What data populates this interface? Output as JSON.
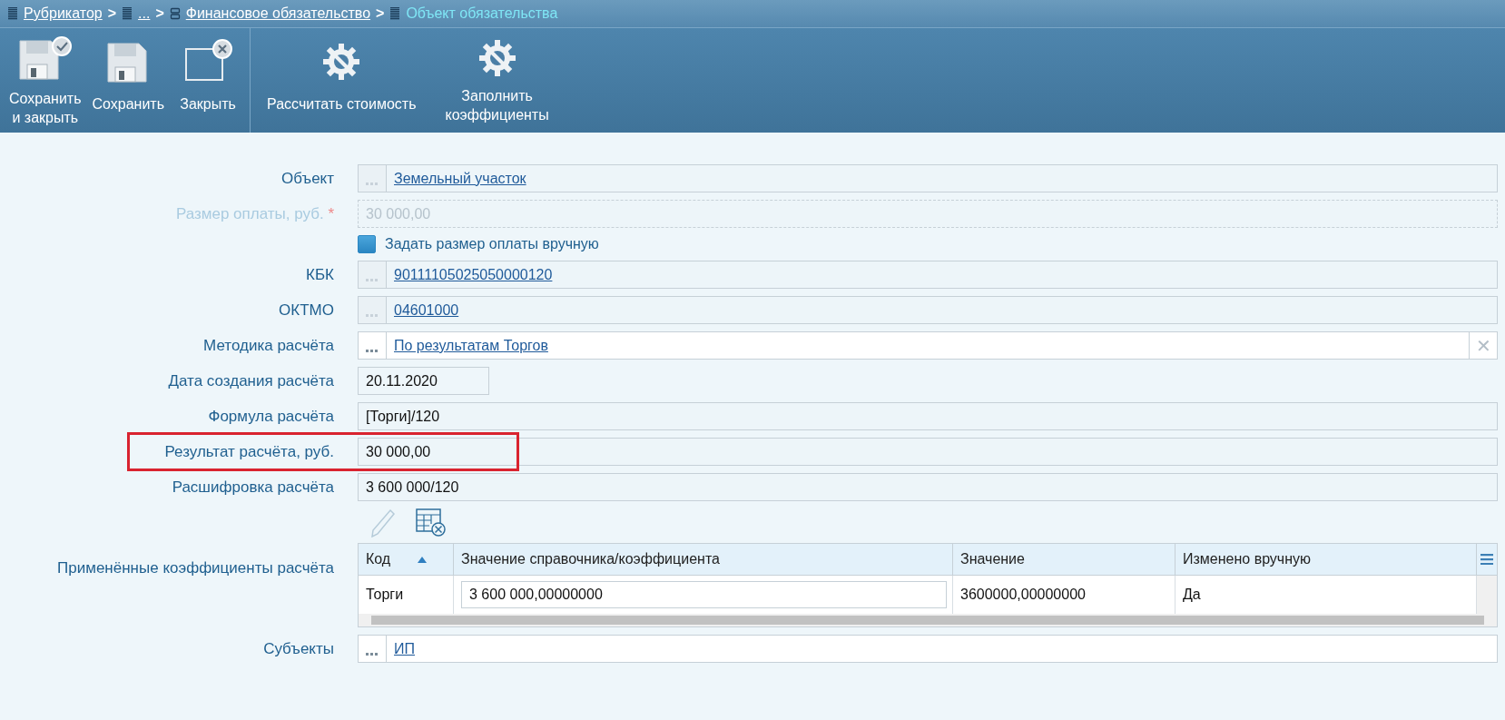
{
  "breadcrumbs": [
    {
      "label": "Рубрикатор",
      "current": false,
      "separator": ">"
    },
    {
      "label": "...",
      "current": false,
      "separator": ">"
    },
    {
      "label": "Финансовое обязательство",
      "current": false,
      "separator": ">"
    },
    {
      "label": "Объект обязательства",
      "current": true
    }
  ],
  "toolbar": {
    "groups": [
      [
        {
          "label": "Сохранить\nи закрыть"
        },
        {
          "label": "Сохранить"
        },
        {
          "label": "Закрыть"
        }
      ],
      [
        {
          "label": "Рассчитать стоимость"
        },
        {
          "label": "Заполнить\nкоэффициенты"
        }
      ]
    ]
  },
  "form": {
    "fields": [
      {
        "kind": "lookup",
        "label": "Объект",
        "value": "Земельный участок",
        "editable": false
      },
      {
        "kind": "text",
        "label": "Размер оплаты, руб.",
        "required_mark": "*",
        "value": "30 000,00",
        "disabled": true
      },
      {
        "kind": "checkbox",
        "label": "Задать размер оплаты вручную",
        "checked": true
      },
      {
        "kind": "lookup",
        "label": "КБК",
        "value": "90111105025050000120",
        "editable": false
      },
      {
        "kind": "lookup",
        "label": "ОКТМО",
        "value": "04601000",
        "editable": false
      },
      {
        "kind": "lookup",
        "label": "Методика расчёта",
        "value": "По результатам Торгов",
        "editable": true,
        "clear": "✕"
      },
      {
        "kind": "date",
        "label": "Дата создания расчёта",
        "value": "20.11.2020"
      },
      {
        "kind": "text",
        "label": "Формула расчёта",
        "value": "[Торги]/120",
        "disabled": false
      },
      {
        "kind": "text",
        "label": "Результат расчёта, руб.",
        "value": "30 000,00",
        "disabled": false,
        "highlighted": true
      },
      {
        "kind": "text",
        "label": "Расшифровка расчёта",
        "value": "3 600 000/120",
        "disabled": false
      },
      {
        "kind": "table",
        "label": "Применённые коэффициенты расчёта",
        "tools": [
          {
            "disabled": true
          },
          {
            "disabled": false
          }
        ],
        "columns": [
          {
            "label": "Код",
            "sorted": true
          },
          {
            "label": "Значение справочника/коэффициента",
            "sorted": false
          },
          {
            "label": "Значение",
            "sorted": false
          },
          {
            "label": "Изменено вручную",
            "sorted": false
          }
        ],
        "rows": [
          {
            "cells": [
              {
                "kind": "text",
                "value": "Торги"
              },
              {
                "kind": "input",
                "value": "3 600 000,00000000"
              },
              {
                "kind": "text",
                "value": "3600000,00000000"
              },
              {
                "kind": "text",
                "value": "Да"
              }
            ]
          }
        ]
      },
      {
        "kind": "lookup",
        "label": "Субъекты",
        "value": "ИП",
        "editable": true
      }
    ]
  }
}
